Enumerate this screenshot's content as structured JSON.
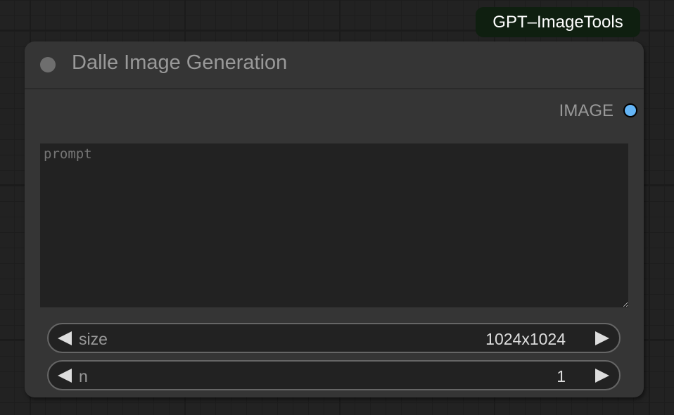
{
  "badge": {
    "label": "GPT–ImageTools"
  },
  "node": {
    "title": "Dalle Image Generation",
    "output": {
      "label": "IMAGE",
      "color": "#64b5f6"
    },
    "prompt": {
      "placeholder": "prompt",
      "value": ""
    },
    "widgets": [
      {
        "label": "size",
        "value": "1024x1024"
      },
      {
        "label": "n",
        "value": "1"
      }
    ]
  }
}
